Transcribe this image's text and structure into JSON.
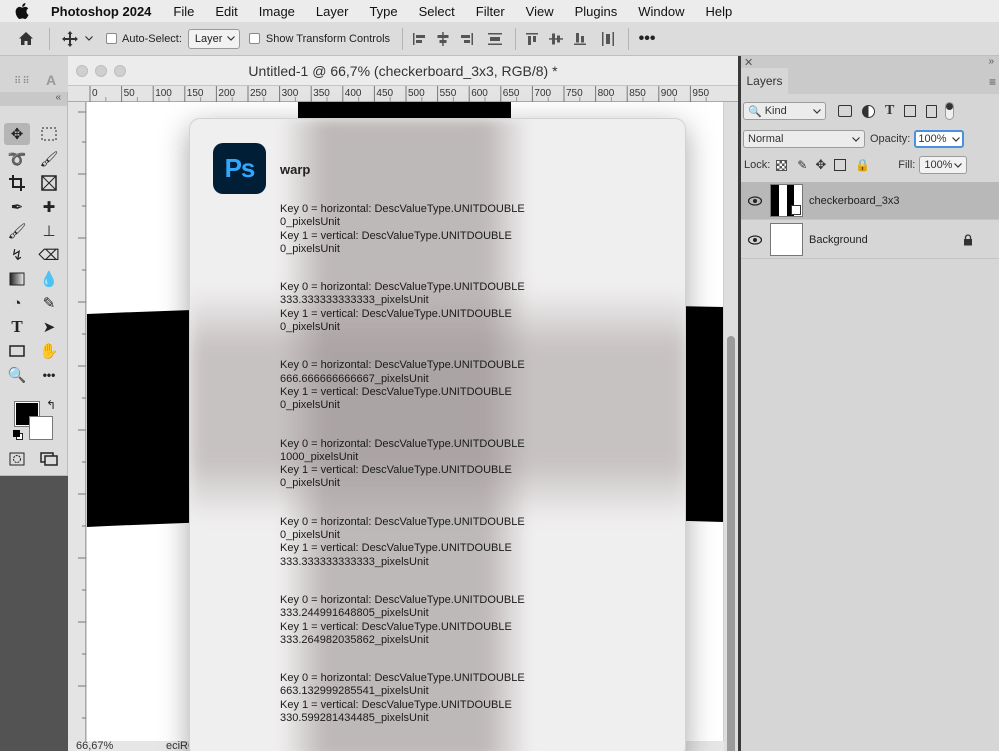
{
  "menubar": {
    "app_name": "Photoshop 2024",
    "items": [
      "File",
      "Edit",
      "Image",
      "Layer",
      "Type",
      "Select",
      "Filter",
      "View",
      "Plugins",
      "Window",
      "Help"
    ]
  },
  "optionsbar": {
    "auto_select_label": "Auto-Select:",
    "auto_select_target": "Layer",
    "show_transform_label": "Show Transform Controls"
  },
  "document": {
    "title": "Untitled-1 @ 66,7% (checkerboard_3x3, RGB/8) *",
    "zoom_status": "66,67%",
    "profile_status": "eciRG",
    "ruler_ticks": [
      "0",
      "50",
      "100",
      "150",
      "200",
      "250",
      "300",
      "350",
      "400",
      "450",
      "500",
      "550",
      "600",
      "650",
      "700",
      "750",
      "800",
      "850",
      "900",
      "950"
    ]
  },
  "dialog": {
    "title": "warp",
    "icon_text": "Ps",
    "groups": [
      [
        "Key 0 = horizontal: DescValueType.UNITDOUBLE",
        "0_pixelsUnit",
        "Key 1 = vertical: DescValueType.UNITDOUBLE",
        "0_pixelsUnit"
      ],
      [
        "Key 0 = horizontal: DescValueType.UNITDOUBLE",
        "333.333333333333_pixelsUnit",
        "Key 1 = vertical: DescValueType.UNITDOUBLE",
        "0_pixelsUnit"
      ],
      [
        "Key 0 = horizontal: DescValueType.UNITDOUBLE",
        "666.666666666667_pixelsUnit",
        "Key 1 = vertical: DescValueType.UNITDOUBLE",
        "0_pixelsUnit"
      ],
      [
        "Key 0 = horizontal: DescValueType.UNITDOUBLE",
        "1000_pixelsUnit",
        "Key 1 = vertical: DescValueType.UNITDOUBLE",
        "0_pixelsUnit"
      ],
      [
        "Key 0 = horizontal: DescValueType.UNITDOUBLE",
        "0_pixelsUnit",
        "Key 1 = vertical: DescValueType.UNITDOUBLE",
        "333.333333333333_pixelsUnit"
      ],
      [
        "Key 0 = horizontal: DescValueType.UNITDOUBLE",
        "333.244991648805_pixelsUnit",
        "Key 1 = vertical: DescValueType.UNITDOUBLE",
        "333.264982035862_pixelsUnit"
      ],
      [
        "Key 0 = horizontal: DescValueType.UNITDOUBLE",
        "663.132999285541_pixelsUnit",
        "Key 1 = vertical: DescValueType.UNITDOUBLE",
        "330.599281434485_pixelsUnit"
      ]
    ]
  },
  "layers_panel": {
    "tab_label": "Layers",
    "filter_kind": "Kind",
    "blend_mode": "Normal",
    "opacity_label": "Opacity:",
    "opacity_value": "100%",
    "lock_label": "Lock:",
    "fill_label": "Fill:",
    "fill_value": "100%",
    "layers": [
      {
        "name": "checkerboard_3x3",
        "selected": true
      },
      {
        "name": "Background",
        "locked": true
      }
    ]
  },
  "colors": {
    "foreground": "#000000",
    "background": "#ffffff",
    "ps_icon_bg": "#001e36",
    "ps_icon_fg": "#31a8ff"
  }
}
